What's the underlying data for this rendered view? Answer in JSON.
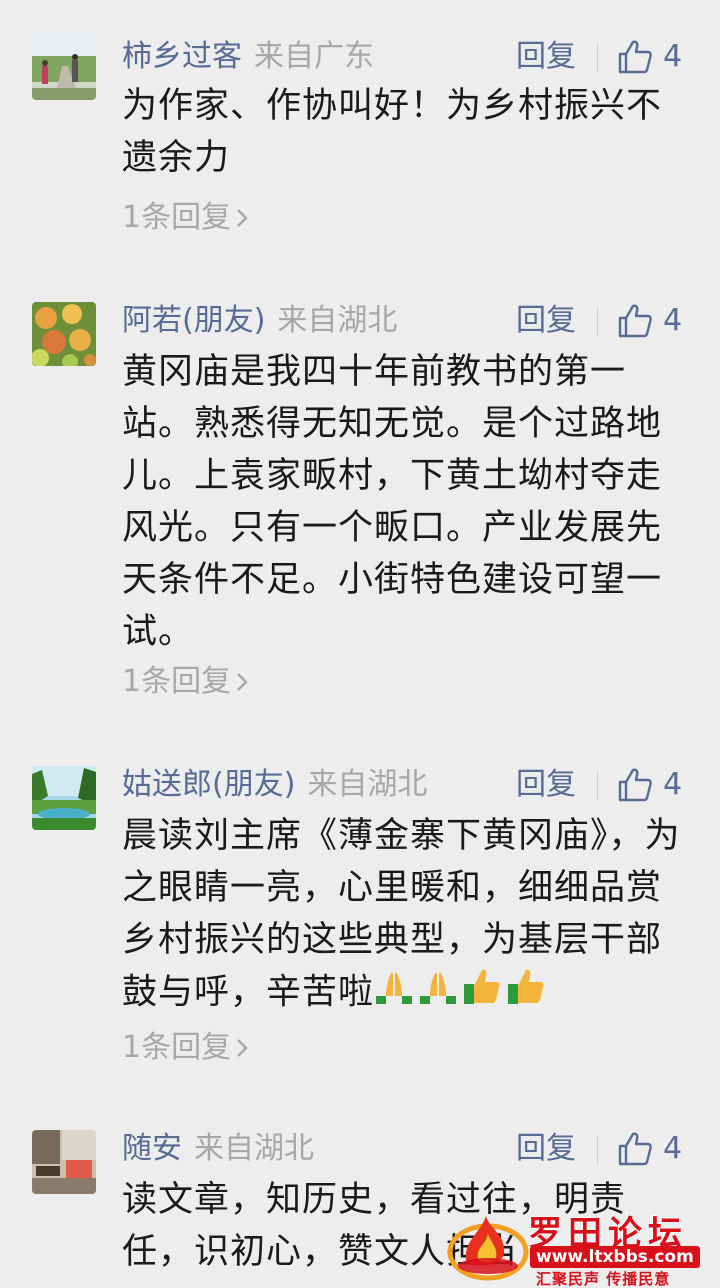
{
  "comments": [
    {
      "nickname": "柿乡过客",
      "from": "来自广东",
      "reply_label": "回复",
      "likes": "4",
      "content": "为作家、作协叫好！为乡村振兴不遗余力",
      "more": "1条回复"
    },
    {
      "nickname": "阿若(朋友)",
      "from": "来自湖北",
      "reply_label": "回复",
      "likes": "4",
      "content": "黄冈庙是我四十年前教书的第一站。熟悉得无知无觉。是个过路地儿。上袁家畈村，下黄土坳村夺走风光。只有一个畈口。产业发展先天条件不足。小街特色建设可望一试。",
      "more": "1条回复"
    },
    {
      "nickname": "姑送郎(朋友)",
      "from": "来自湖北",
      "reply_label": "回复",
      "likes": "4",
      "content": "晨读刘主席《薄金寨下黄冈庙》，为之眼睛一亮，心里暖和，细细品赏乡村振兴的这些典型，为基层干部鼓与呼，辛苦啦",
      "emojis": [
        "pray",
        "pray",
        "thumbs-up",
        "thumbs-up"
      ],
      "more": "1条回复"
    },
    {
      "nickname": "随安",
      "from": "来自湖北",
      "reply_label": "回复",
      "likes": "4",
      "content": "读文章，知历史，看过往，明责任，识初心，赞文人担当"
    }
  ],
  "watermark": {
    "title": "罗田论坛",
    "url": "www.ltxbbs.com",
    "slogan": "汇聚民声 传播民意"
  },
  "colors": {
    "link": "#576b95",
    "muted": "#a7a7a7",
    "text": "#1a1a1a",
    "background": "#ededed",
    "watermark_red": "#d8101a"
  }
}
